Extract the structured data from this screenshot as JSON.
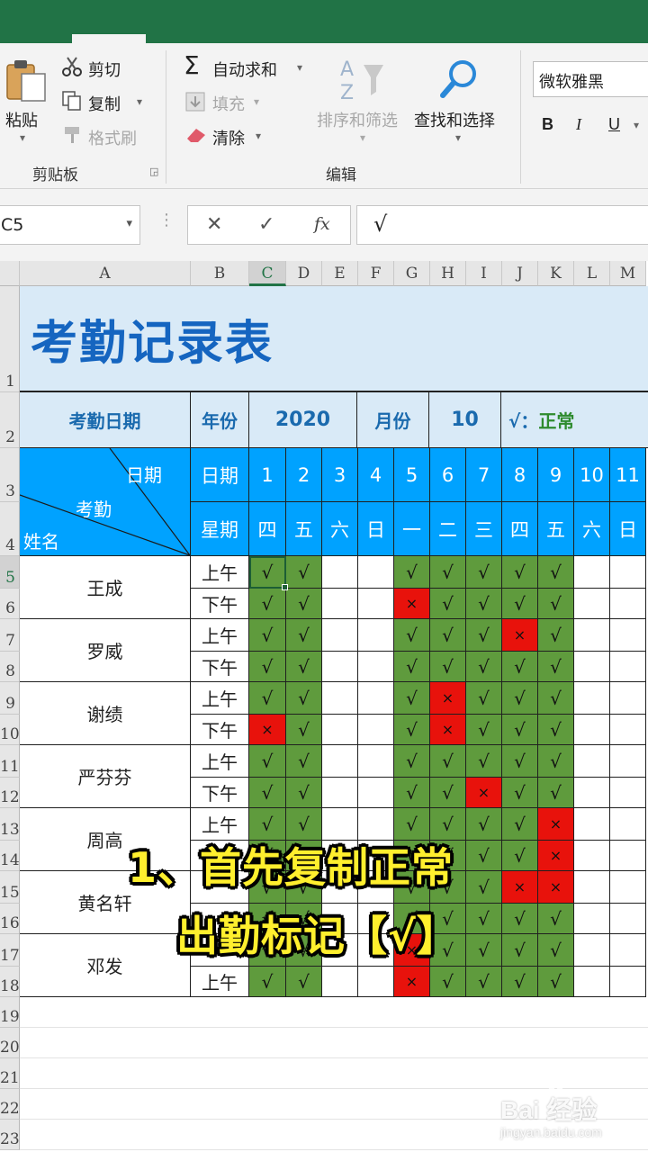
{
  "ribbon": {
    "clipboard": {
      "paste_label": "粘贴",
      "cut_label": "剪切",
      "copy_label": "复制",
      "format_painter_label": "格式刷",
      "group_label": "剪贴板"
    },
    "editing": {
      "autosum_label": "自动求和",
      "fill_label": "填充",
      "clear_label": "清除",
      "sort_filter_label": "排序和筛选",
      "find_select_label": "查找和选择",
      "group_label": "编辑"
    },
    "font": {
      "font_name": "微软雅黑",
      "bold_label": "B",
      "italic_label": "I",
      "underline_label": "U"
    }
  },
  "formula_bar": {
    "name_box": "C5",
    "cancel": "✕",
    "enter": "✓",
    "fx": "fx",
    "content": "√"
  },
  "columns": [
    "A",
    "B",
    "C",
    "D",
    "E",
    "F",
    "G",
    "H",
    "I",
    "J",
    "K",
    "L",
    "M"
  ],
  "row_numbers": [
    "1",
    "2",
    "3",
    "4",
    "5",
    "6",
    "7",
    "8",
    "9",
    "10",
    "11",
    "12",
    "13",
    "14",
    "15",
    "16",
    "17",
    "18",
    "19",
    "20",
    "21",
    "22",
    "23"
  ],
  "sheet": {
    "title": "考勤记录表",
    "date_label": "考勤日期",
    "year_label": "年份",
    "year_value": "2020",
    "month_label": "月份",
    "month_value": "10",
    "legend_mark": "√：",
    "legend_text": "正常",
    "corner_date": "日期",
    "corner_attendance": "考勤",
    "corner_name": "姓名",
    "day_header": "日期",
    "weekday_header": "星期",
    "days": [
      "1",
      "2",
      "3",
      "4",
      "5",
      "6",
      "7",
      "8",
      "9",
      "10",
      "11"
    ],
    "weekdays": [
      "四",
      "五",
      "六",
      "日",
      "一",
      "二",
      "三",
      "四",
      "五",
      "六",
      "日"
    ],
    "employees": [
      {
        "name": "王成",
        "rows": [
          {
            "period": "上午",
            "marks": [
              "√",
              "√",
              "",
              "",
              "√",
              "√",
              "√",
              "√",
              "√",
              "",
              ""
            ]
          },
          {
            "period": "下午",
            "marks": [
              "√",
              "√",
              "",
              "",
              "×",
              "√",
              "√",
              "√",
              "√",
              "",
              ""
            ]
          }
        ]
      },
      {
        "name": "罗威",
        "rows": [
          {
            "period": "上午",
            "marks": [
              "√",
              "√",
              "",
              "",
              "√",
              "√",
              "√",
              "×",
              "√",
              "",
              ""
            ]
          },
          {
            "period": "下午",
            "marks": [
              "√",
              "√",
              "",
              "",
              "√",
              "√",
              "√",
              "√",
              "√",
              "",
              ""
            ]
          }
        ]
      },
      {
        "name": "谢绩",
        "rows": [
          {
            "period": "上午",
            "marks": [
              "√",
              "√",
              "",
              "",
              "√",
              "×",
              "√",
              "√",
              "√",
              "",
              ""
            ]
          },
          {
            "period": "下午",
            "marks": [
              "×",
              "√",
              "",
              "",
              "√",
              "×",
              "√",
              "√",
              "√",
              "",
              ""
            ]
          }
        ]
      },
      {
        "name": "严芬芬",
        "rows": [
          {
            "period": "上午",
            "marks": [
              "√",
              "√",
              "",
              "",
              "√",
              "√",
              "√",
              "√",
              "√",
              "",
              ""
            ]
          },
          {
            "period": "下午",
            "marks": [
              "√",
              "√",
              "",
              "",
              "√",
              "√",
              "×",
              "√",
              "√",
              "",
              ""
            ]
          }
        ]
      },
      {
        "name": "周高",
        "rows": [
          {
            "period": "上午",
            "marks": [
              "√",
              "√",
              "",
              "",
              "√",
              "√",
              "√",
              "√",
              "×",
              "",
              ""
            ]
          },
          {
            "period": "",
            "marks": [
              "√",
              "√",
              "",
              "",
              "√",
              "√",
              "√",
              "√",
              "×",
              "",
              ""
            ]
          }
        ]
      },
      {
        "name": "黄名轩",
        "rows": [
          {
            "period": "",
            "marks": [
              "√",
              "√",
              "",
              "",
              "√",
              "√",
              "√",
              "×",
              "×",
              "",
              ""
            ]
          },
          {
            "period": "",
            "marks": [
              "√",
              "√",
              "",
              "",
              "√",
              "√",
              "√",
              "√",
              "√",
              "",
              ""
            ]
          }
        ]
      },
      {
        "name": "邓发",
        "rows": [
          {
            "period": "",
            "marks": [
              "√",
              "√",
              "",
              "",
              "×",
              "√",
              "√",
              "√",
              "√",
              "",
              ""
            ]
          },
          {
            "period": "上午",
            "marks": [
              "√",
              "√",
              "",
              "",
              "×",
              "√",
              "√",
              "√",
              "√",
              "",
              ""
            ]
          }
        ]
      }
    ]
  },
  "overlay": {
    "caption_line1": "1、首先复制正常",
    "caption_line2": "出勤标记【√】",
    "watermark_main": "Bai  经验",
    "watermark_url": "jingyan.baidu.com"
  },
  "colors": {
    "excel_green": "#217346",
    "present_green": "#5f9b3d",
    "absent_red": "#e8120c",
    "header_blue": "#00a2ff",
    "title_blue": "#1565c0",
    "title_bg": "#d9eaf7",
    "caption_yellow": "#ffef2e"
  }
}
